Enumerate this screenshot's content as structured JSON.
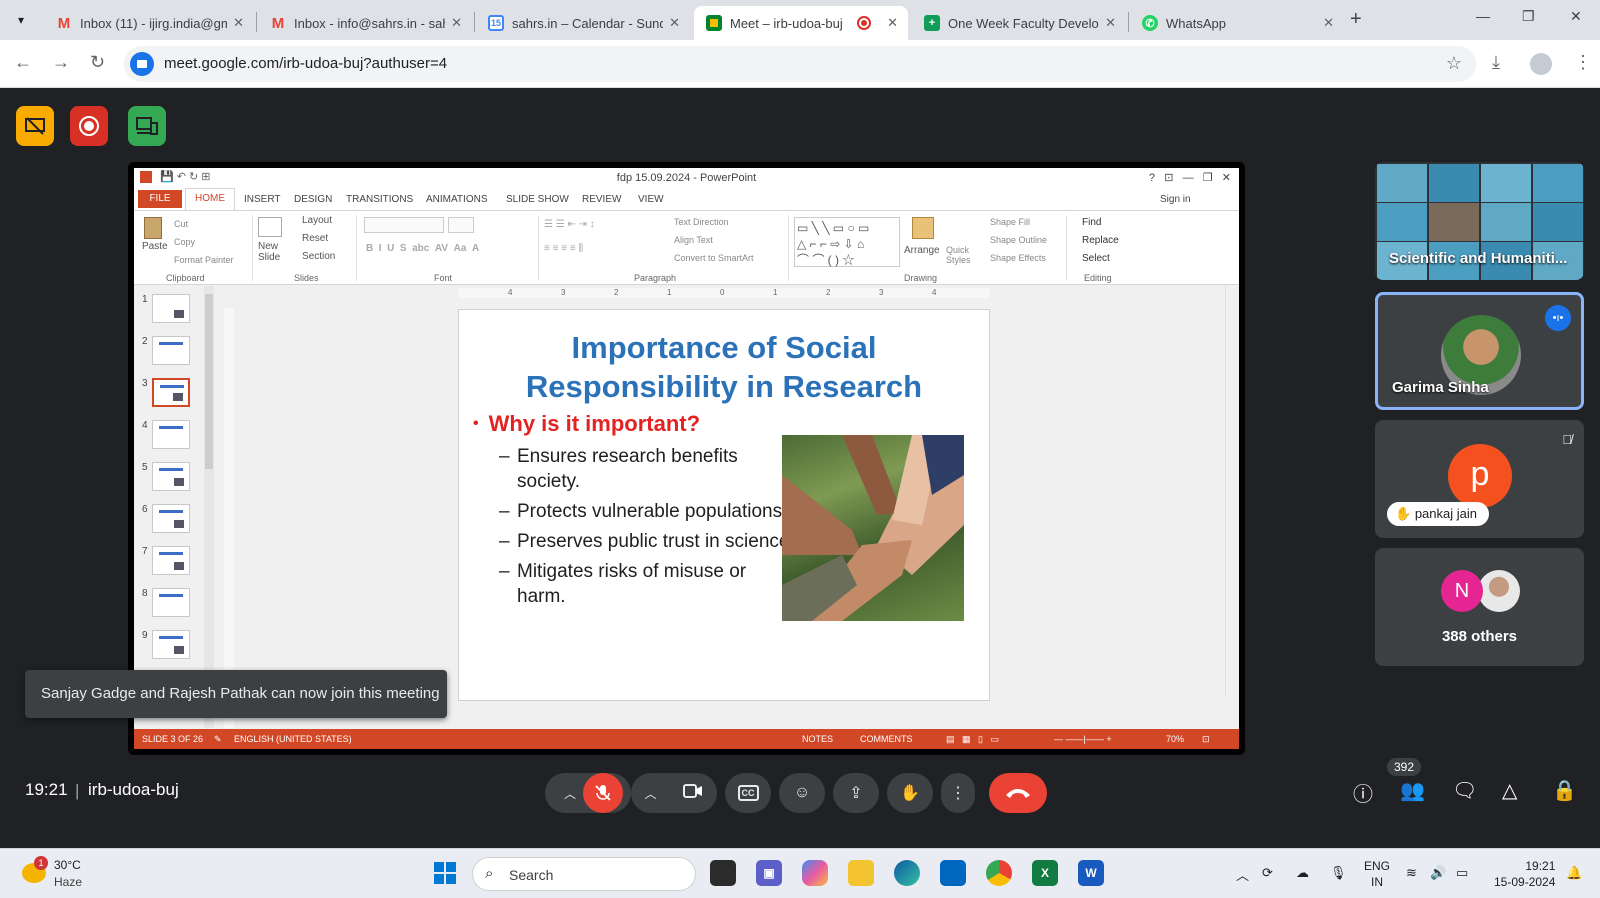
{
  "browser": {
    "tabs": [
      {
        "title": "Inbox (11) - ijirg.india@gm",
        "icon": "gmail-icon"
      },
      {
        "title": "Inbox - info@sahrs.in - sah",
        "icon": "gmail-icon"
      },
      {
        "title": "sahrs.in – Calendar - Sunda",
        "icon": "calendar-icon",
        "badge": "15"
      },
      {
        "title": "Meet – irb-udoa-buj",
        "icon": "meet-icon",
        "active": true
      },
      {
        "title": "One Week Faculty Develop",
        "icon": "sheets-icon"
      },
      {
        "title": "WhatsApp",
        "icon": "whatsapp-icon"
      }
    ],
    "url": "meet.google.com/irb-udoa-buj?authuser=4"
  },
  "presentation": {
    "window_title": "fdp 15.09.2024 - PowerPoint",
    "sign_in": "Sign in",
    "ribbon_tabs": [
      "FILE",
      "HOME",
      "INSERT",
      "DESIGN",
      "TRANSITIONS",
      "ANIMATIONS",
      "SLIDE SHOW",
      "REVIEW",
      "VIEW"
    ],
    "clipboard": {
      "paste": "Paste",
      "cut": "Cut",
      "copy": "Copy",
      "format_painter": "Format Painter",
      "group": "Clipboard"
    },
    "slides_group": {
      "new_slide": "New Slide",
      "layout": "Layout",
      "reset": "Reset",
      "section": "Section",
      "group": "Slides"
    },
    "font_group": "Font",
    "paragraph": {
      "text_direction": "Text Direction",
      "align_text": "Align Text",
      "convert": "Convert to SmartArt",
      "group": "Paragraph"
    },
    "drawing": {
      "arrange": "Arrange",
      "quick_styles": "Quick Styles",
      "shape_fill": "Shape Fill",
      "shape_outline": "Shape Outline",
      "shape_effects": "Shape Effects",
      "group": "Drawing"
    },
    "editing": {
      "find": "Find",
      "replace": "Replace",
      "select": "Select",
      "group": "Editing"
    },
    "ruler_ticks": [
      "4",
      "3",
      "2",
      "1",
      "0",
      "1",
      "2",
      "3",
      "4"
    ],
    "thumbnail_numbers": [
      "1",
      "2",
      "3",
      "4",
      "5",
      "6",
      "7",
      "8",
      "9"
    ],
    "selected_slide": 3,
    "slide": {
      "title": "Importance of Social Responsibility in Research",
      "question": "Why is it important?",
      "bullets": [
        "Ensures research benefits society.",
        "Protects vulnerable populations.",
        "Preserves public trust in science.",
        "Mitigates risks of misuse or harm."
      ]
    },
    "status": {
      "slide_count": "SLIDE 3 OF 26",
      "language": "ENGLISH (UNITED STATES)",
      "notes": "NOTES",
      "comments": "COMMENTS",
      "zoom": "70%"
    }
  },
  "participants": {
    "tile1_label": "Scientific and Humaniti...",
    "tile2_name": "Garima Sinha",
    "tile3_initial": "p",
    "tile3_name": "pankaj jain",
    "tile4_initial": "N",
    "tile4_others": "388 others"
  },
  "toast": "Sanjay Gadge and Rajesh Pathak can now join this meeting",
  "meeting": {
    "time": "19:21",
    "code": "irb-udoa-buj",
    "people_count": "392"
  },
  "taskbar": {
    "temperature": "30°C",
    "weather": "Haze",
    "weather_badge": "1",
    "search_placeholder": "Search",
    "lang_top": "ENG",
    "lang_bottom": "IN",
    "time": "19:21",
    "date": "15-09-2024"
  },
  "colors": {
    "accent": "#1a73e8",
    "ppt_orange": "#d24726",
    "slide_title": "#2b72b8",
    "slide_question": "#e32222",
    "end_call": "#ea4335"
  }
}
